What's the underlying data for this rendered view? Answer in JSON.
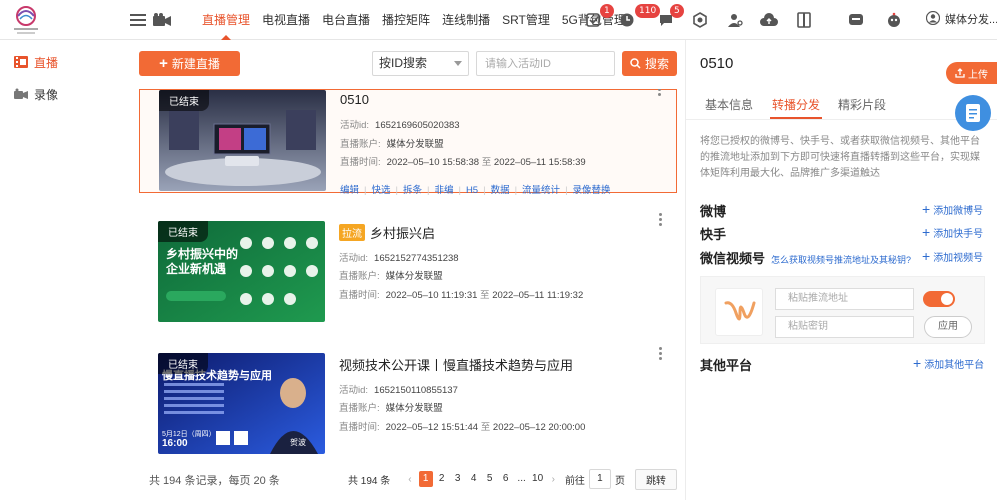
{
  "nav": {
    "items": [
      {
        "label": "直播管理",
        "active": true
      },
      {
        "label": "电视直播"
      },
      {
        "label": "电台直播"
      },
      {
        "label": "播控矩阵"
      },
      {
        "label": "连线制播"
      },
      {
        "label": "SRT管理"
      },
      {
        "label": "5G背包管理"
      }
    ],
    "badges": [
      "1",
      "110",
      "5"
    ],
    "user": "媒体分发..."
  },
  "sidebar": {
    "items": [
      {
        "label": "直播",
        "active": true
      },
      {
        "label": "录像"
      }
    ]
  },
  "toolbar": {
    "new_label": "新建直播",
    "search_type": "按ID搜索",
    "search_placeholder": "请输入活动ID",
    "search_label": "搜索"
  },
  "labels": {
    "ended": "已结束",
    "activity_id": "活动id:",
    "account": "直播账户:",
    "time": "直播时间:",
    "to": "至"
  },
  "cards": [
    {
      "title": "0510",
      "tag": "",
      "id": "1652169605020383",
      "account": "媒体分发联盟",
      "start": "2022–05–10 15:58:38",
      "end": "2022–05–11 15:58:39",
      "actions": [
        "编辑",
        "快选",
        "拆条",
        "非编",
        "H5",
        "数据",
        "流量统计",
        "录像替换"
      ]
    },
    {
      "title": "乡村振兴启",
      "tag": "拉流",
      "id": "1652152774351238",
      "account": "媒体分发联盟",
      "start": "2022–05–10 11:19:31",
      "end": "2022–05–11 11:19:32",
      "thumb": {
        "l1": "乡村振兴中的",
        "l2": "企业新机遇"
      }
    },
    {
      "title": "视频技术公开课丨慢直播技术趋势与应用",
      "tag": "",
      "id": "1652150110855137",
      "account": "媒体分发联盟",
      "start": "2022–05–12 15:51:44",
      "end": "2022–05–12 20:00:00",
      "thumb": {
        "l1": "慢直播技术趋势与应用",
        "date": "5月12日（周四）",
        "time": "16:00",
        "speaker": "贺波"
      }
    }
  ],
  "pager": {
    "summary": "共 194 条记录，每页 20 条",
    "total": "共 194 条",
    "pages": [
      "1",
      "2",
      "3",
      "4",
      "5",
      "6",
      "...",
      "10"
    ],
    "goto": "前往",
    "goto_value": "1",
    "page_unit": "页",
    "jump": "跳转"
  },
  "right": {
    "title": "0510",
    "tabs": [
      "基本信息",
      "转播分发",
      "精彩片段"
    ],
    "active_tab": "转播分发",
    "desc": "将您已授权的微博号、快手号、或者获取微信视频号、其他平台的推流地址添加到下方即可快速将直播转播到这些平台，实现媒体矩阵利用最大化、品牌推广多渠道触达",
    "weibo": "微博",
    "weibo_add": "添加微博号",
    "kuaishou": "快手",
    "kuaishou_add": "添加快手号",
    "wechat": "微信视频号",
    "wechat_help": "怎么获取视频号推流地址及其秘钥?",
    "wechat_add": "添加视频号",
    "push_placeholder": "粘贴推流地址",
    "key_placeholder": "粘贴密钥",
    "apply": "应用",
    "other": "其他平台",
    "other_add": "添加其他平台"
  },
  "float": {
    "upload": "上传"
  },
  "colors": {
    "accent": "#f26a35",
    "link": "#2d6bcf"
  }
}
